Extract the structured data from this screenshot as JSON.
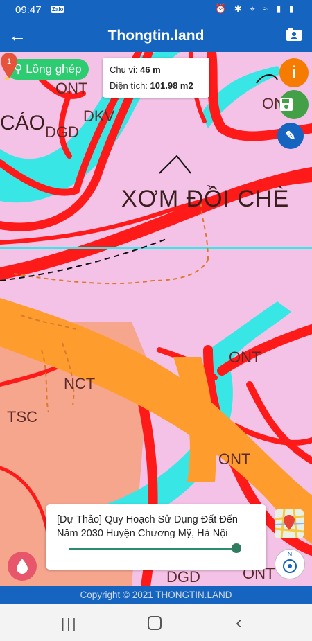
{
  "status_bar": {
    "time": "09:47",
    "app_badge": "Zalo",
    "right_icons": "⏰ ✱ ⌖ ≈ ▮ ▮"
  },
  "app_bar": {
    "title": "Thongtin.land",
    "back_icon": "arrow-left-icon",
    "action_icon": "contact-card-icon"
  },
  "map": {
    "overlay_chip": "Lồng ghép",
    "info": {
      "perimeter_label": "Chu vi:",
      "perimeter_value": "46 m",
      "area_label": "Diện tích:",
      "area_value": "101.98 m2"
    },
    "labels": {
      "xom": "XƠM ĐỒI CHÈ",
      "cao": "CÁO",
      "ont_a": "ONT",
      "ont_b": "ONT",
      "ont_c": "ONT",
      "ont_d": "ONT",
      "dgd_a": "DGD",
      "dgd_b": "DGD",
      "dkv": "DKV",
      "tsc": "TSC",
      "nct": "NCT",
      "ont_e": "ONT"
    },
    "marker_number": "1",
    "layer_title": "[Dự Thảo] Quy Hoạch Sử Dụng Đất Đến Năm 2030 Huyện Chương Mỹ, Hà Nội",
    "opacity_slider": 0.97,
    "compass_label": "N"
  },
  "colors": {
    "appbar": "#1565c0",
    "pink_zone": "#f5c2e7",
    "red_road": "#ff1a1a",
    "orange_road": "#ff9c2e",
    "water": "#39e6e6",
    "chip": "#2ecc71"
  },
  "footer": {
    "copyright": "Copyright © 2021 THONGTIN.LAND"
  }
}
